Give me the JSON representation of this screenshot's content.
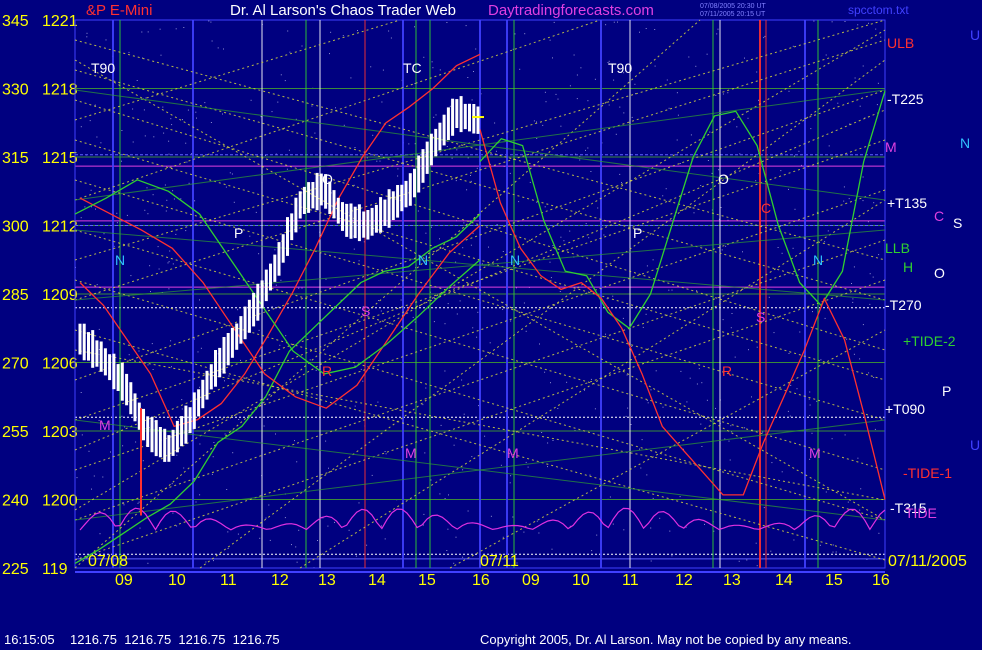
{
  "header": {
    "symbol": "&P E-Mini",
    "site_title": "Dr. Al Larson's Chaos Trader Web",
    "site_url": "Daytradingforecasts.com",
    "timestamp_1": "07/08/2005 20:30 UT",
    "timestamp_2": "07/11/2005 20:15 UT",
    "filename": "spcctom.txt"
  },
  "footer": {
    "time": "16:15:05",
    "quote": "1216.75  1216.75  1216.75  1216.75",
    "copyright": "Copyright 2005, Dr. Al Larson. May not be copied by any means."
  },
  "colors": {
    "background": "#000080",
    "price_bars": "#ffffff",
    "red_line": "#ff3030",
    "green_line": "#30d030",
    "magenta_line": "#e030e0",
    "yellow_dotted": "#d8d840",
    "axis_text": "#ffff00"
  },
  "chart_data": {
    "type": "line",
    "title": "&P E-Mini",
    "ylim": [
      1197,
      1221
    ],
    "y_ticks": [
      {
        "left": "345",
        "price": "1221"
      },
      {
        "left": "330",
        "price": "1218"
      },
      {
        "left": "315",
        "price": "1215"
      },
      {
        "left": "300",
        "price": "1212"
      },
      {
        "left": "285",
        "price": "1209"
      },
      {
        "left": "270",
        "price": "1206"
      },
      {
        "left": "255",
        "price": "1203"
      },
      {
        "left": "240",
        "price": "1200"
      },
      {
        "left": "225",
        "price": "119"
      }
    ],
    "x_ticks": [
      "09",
      "10",
      "11",
      "12",
      "13",
      "14",
      "15",
      "16",
      "09",
      "10",
      "11",
      "12",
      "13",
      "14",
      "15",
      "16"
    ],
    "date_labels": [
      "07/08",
      "07/11",
      "07/11/2005"
    ],
    "right_labels": [
      "ULB",
      "-T225",
      "M",
      "+T135",
      "LLB",
      "H",
      "-T270",
      "+TIDE-2",
      "+T090",
      "-TIDE-1",
      "-T315",
      "TIDE"
    ],
    "far_right_labels": [
      "U",
      "N",
      "C",
      "S",
      "O",
      "P",
      "U"
    ],
    "in_chart_labels": [
      "T90",
      "TC",
      "T90",
      "N",
      "N",
      "N",
      "N",
      "M",
      "M",
      "M",
      "M",
      "P",
      "P",
      "O",
      "O",
      "R",
      "R",
      "C",
      "S",
      "S"
    ],
    "series": [
      {
        "name": "price",
        "values": [
          1207,
          1206.2,
          1205,
          1203,
          1202.2,
          1203.5,
          1205.5,
          1207,
          1208.5,
          1210.5,
          1213,
          1213.6,
          1212.2,
          1212,
          1212.7,
          1213.6,
          1215.5,
          1216.9,
          1216.6
        ]
      },
      {
        "name": "red",
        "values": [
          1209.5,
          1208.5,
          1207,
          1205.5,
          1203.2,
          1203.5,
          1204.2,
          1205.5,
          1207.2,
          1209,
          1211,
          1213.2,
          1215,
          1216.5,
          1217.2,
          1218,
          1219,
          1219.5
        ]
      },
      {
        "name": "green",
        "values": [
          1197.2,
          1197.8,
          1198.5,
          1199.2,
          1199.8,
          1200.8,
          1202.5,
          1203.2,
          1204.5,
          1206.5,
          1207.5,
          1208.5,
          1209.5,
          1210,
          1210.2,
          1211,
          1211.5,
          1212.5
        ]
      },
      {
        "name": "green_forecast",
        "values": [
          1214.8,
          1215.8,
          1215.5,
          1212.2,
          1210,
          1209.8,
          1208.2,
          1207.5,
          1209,
          1212,
          1215,
          1216.8,
          1217,
          1215.5,
          1212,
          1209.5,
          1208.5,
          1210,
          1214.8,
          1217.9
        ]
      },
      {
        "name": "red_forecast",
        "values": [
          1216.2,
          1213,
          1211,
          1209.8,
          1209.2,
          1209.5,
          1208.8,
          1207.5,
          1205.5,
          1203.2,
          1202.2,
          1201.2,
          1200.2,
          1200.2,
          1202.5,
          1204.5,
          1206.5,
          1208.8,
          1207,
          1203.6,
          1200
        ]
      }
    ]
  }
}
